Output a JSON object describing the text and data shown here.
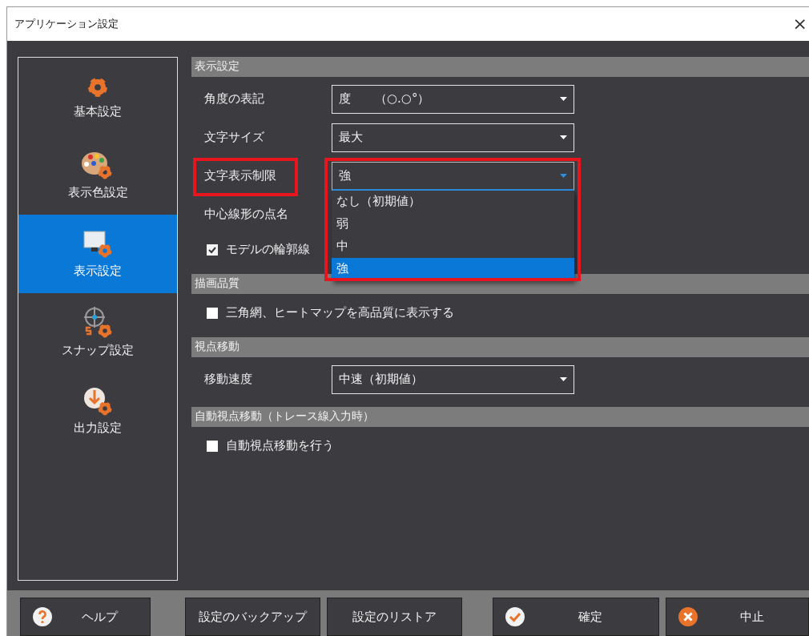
{
  "window": {
    "title": "アプリケーション設定",
    "close": "×"
  },
  "sidebar": {
    "items": [
      {
        "label": "基本設定",
        "selected": false
      },
      {
        "label": "表示色設定",
        "selected": false
      },
      {
        "label": "表示設定",
        "selected": true
      },
      {
        "label": "スナップ設定",
        "selected": false
      },
      {
        "label": "出力設定",
        "selected": false
      }
    ]
  },
  "sections": [
    {
      "title": "表示設定",
      "rows": [
        {
          "kind": "select",
          "label": "角度の表記",
          "value": "度　　（○.○°）"
        },
        {
          "kind": "select",
          "label": "文字サイズ",
          "value": "最大"
        },
        {
          "kind": "select",
          "label": "文字表示制限",
          "value": "強",
          "highlighted": true,
          "expanded": true,
          "options": [
            {
              "label": "なし（初期値）",
              "selected": false
            },
            {
              "label": "弱",
              "selected": false
            },
            {
              "label": "中",
              "selected": false
            },
            {
              "label": "強",
              "selected": true
            }
          ]
        },
        {
          "kind": "label",
          "label": "中心線形の点名"
        },
        {
          "kind": "checkbox",
          "label": "モデルの輪郭線",
          "checked": true
        }
      ]
    },
    {
      "title": "描画品質",
      "rows": [
        {
          "kind": "checkbox",
          "label": "三角網、ヒートマップを高品質に表示する",
          "checked": false
        }
      ]
    },
    {
      "title": "視点移動",
      "rows": [
        {
          "kind": "select",
          "label": "移動速度",
          "value": "中速（初期値）"
        }
      ]
    },
    {
      "title": "自動視点移動（トレース線入力時）",
      "rows": [
        {
          "kind": "checkbox",
          "label": "自動視点移動を行う",
          "checked": false
        }
      ]
    }
  ],
  "buttons": [
    {
      "kind": "help",
      "label": "ヘルプ"
    },
    {
      "kind": "plain",
      "label": "設定のバックアップ"
    },
    {
      "kind": "plain",
      "label": "設定のリストア"
    },
    {
      "kind": "ok",
      "label": "確定"
    },
    {
      "kind": "cancel",
      "label": "中止"
    }
  ]
}
